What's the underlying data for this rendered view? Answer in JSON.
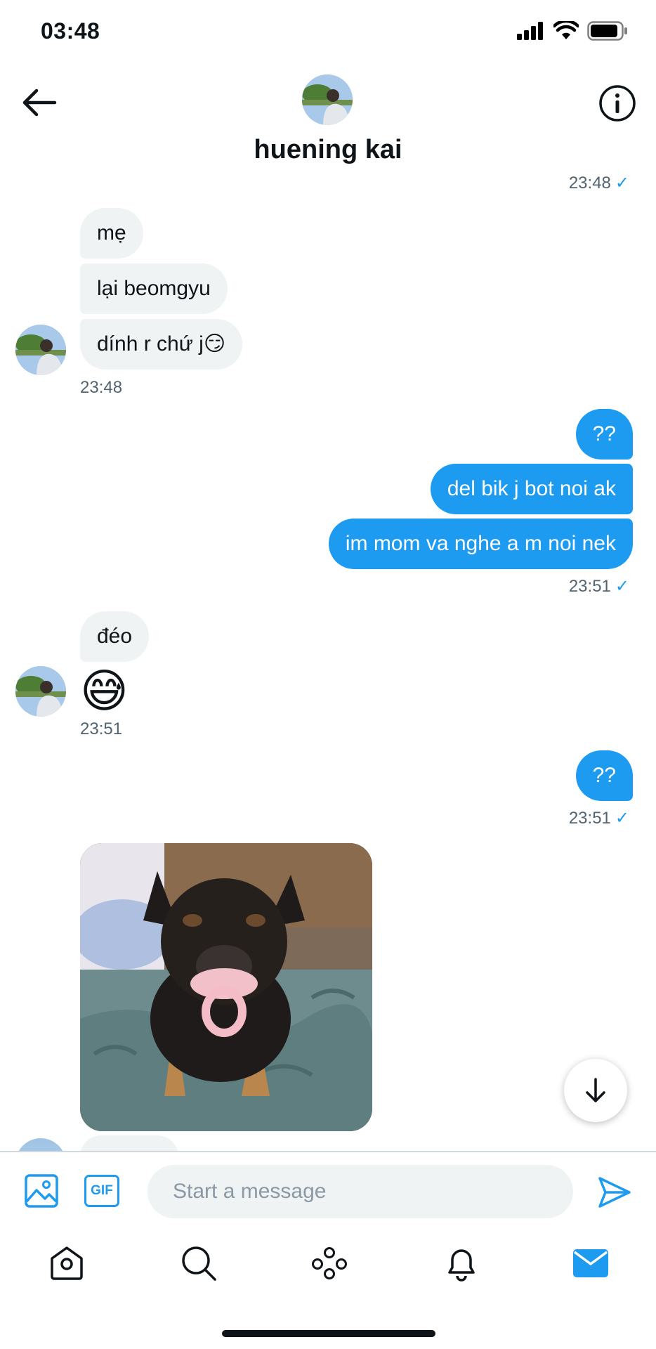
{
  "status_bar": {
    "time": "03:48"
  },
  "header": {
    "name": "huening kai"
  },
  "messages": {
    "top_time": "23:48",
    "group1": {
      "m1": "mẹ",
      "m2": "lại beomgyu",
      "m3": "dính r chứ j😏",
      "time": "23:48"
    },
    "group2": {
      "m1": "??",
      "m2": "del bik j bot noi ak",
      "m3": "im mom va nghe a m noi nek",
      "time": "23:51"
    },
    "group3": {
      "m1": "đéo",
      "emoji": "😅",
      "time": "23:51"
    },
    "group4": {
      "m1": "??",
      "time": "23:51"
    }
  },
  "composer": {
    "placeholder": "Start a message",
    "gif_label": "GIF"
  },
  "icons": {
    "back": "arrow-left-icon",
    "info": "info-icon",
    "image": "image-icon",
    "gif": "gif-icon",
    "send": "send-icon",
    "home": "home-icon",
    "search": "search-icon",
    "spaces": "communities-icon",
    "notifications": "bell-icon",
    "messages": "mail-icon",
    "scroll_down": "arrow-down-icon"
  },
  "colors": {
    "accent": "#1d9bf0",
    "bubble_in": "#eff3f4",
    "text": "#0f1419",
    "muted": "#536471"
  }
}
